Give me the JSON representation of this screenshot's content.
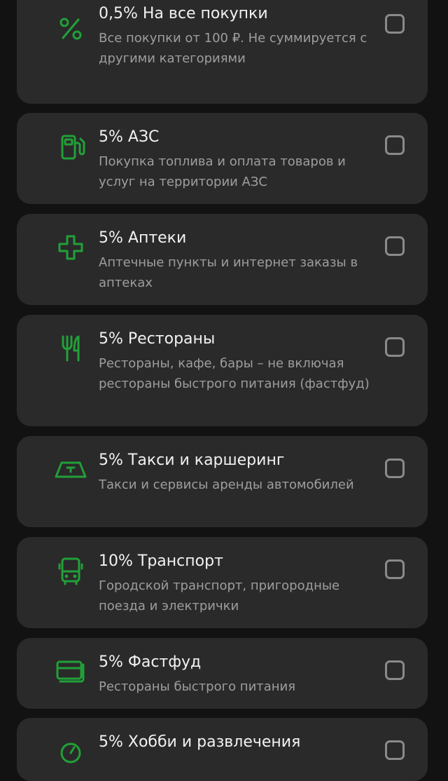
{
  "items": [
    {
      "title": "0,5% На все покупки",
      "description": "Все покупки от 100 ₽. Не суммируется с другими категориями",
      "icon": "percent-icon",
      "checked": false
    },
    {
      "title": "5% АЗС",
      "description": "Покупка топлива и оплата товаров и услуг на территории АЗС",
      "icon": "fuel-pump-icon",
      "checked": false
    },
    {
      "title": "5% Аптеки",
      "description": "Аптечные пункты и интернет заказы в аптеках",
      "icon": "medical-cross-icon",
      "checked": false
    },
    {
      "title": "5% Рестораны",
      "description": "Рестораны, кафе, бары – не включая рестораны быстрого питания (фастфуд)",
      "icon": "fork-knife-icon",
      "checked": false
    },
    {
      "title": "5% Такси и каршеринг",
      "description": "Такси и сервисы аренды автомобилей",
      "icon": "taxi-icon",
      "checked": false
    },
    {
      "title": "10% Транспорт",
      "description": "Городской транспорт, пригородные поезда и электрички",
      "icon": "bus-icon",
      "checked": false
    },
    {
      "title": "5% Фастфуд",
      "description": "Рестораны быстрого питания",
      "icon": "fastfood-icon",
      "checked": false
    },
    {
      "title": "5% Хобби и развлечения",
      "description": "",
      "icon": "hobby-icon",
      "checked": false
    }
  ],
  "colors": {
    "accent": "#21a038",
    "background": "#121212",
    "card": "#2a2a2a",
    "title": "#f2f2f2",
    "description": "#9e9e9e",
    "checkbox_border": "#8a8a8a"
  }
}
